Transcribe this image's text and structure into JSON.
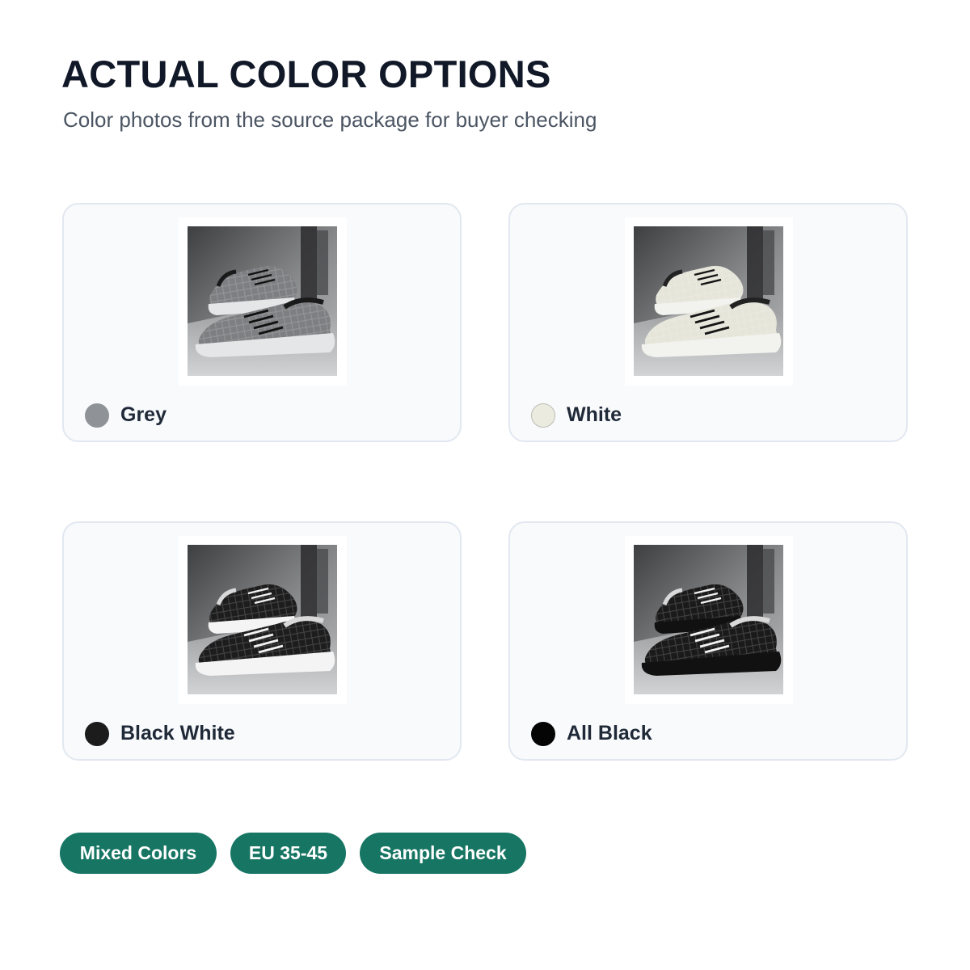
{
  "header": {
    "title": "ACTUAL COLOR OPTIONS",
    "subtitle": "Color photos from the source package for buyer checking"
  },
  "variants": [
    {
      "label": "Grey",
      "swatch_color": "#8f9398",
      "upper_color": "#7d7f82",
      "sole_color": "#e4e6e8",
      "lace_color": "#111111",
      "collar_color": "#1a1a1a"
    },
    {
      "label": "White",
      "swatch_color": "#ecebe0",
      "upper_color": "#e6e5da",
      "sole_color": "#f2f2ee",
      "lace_color": "#141414",
      "collar_color": "#222222"
    },
    {
      "label": "Black White",
      "swatch_color": "#1c1c1c",
      "upper_color": "#1d1d1d",
      "sole_color": "#f4f4f4",
      "lace_color": "#f2f2f2",
      "collar_color": "#d9d9d9"
    },
    {
      "label": "All Black",
      "swatch_color": "#050505",
      "upper_color": "#1a1a1a",
      "sole_color": "#111111",
      "lace_color": "#f2f2f2",
      "collar_color": "#d9d9d9"
    }
  ],
  "tags": [
    "Mixed Colors",
    "EU 35-45",
    "Sample Check"
  ],
  "colors": {
    "accent": "#177563",
    "card_bg": "#f8fafc",
    "card_border": "#e2e8f0"
  }
}
